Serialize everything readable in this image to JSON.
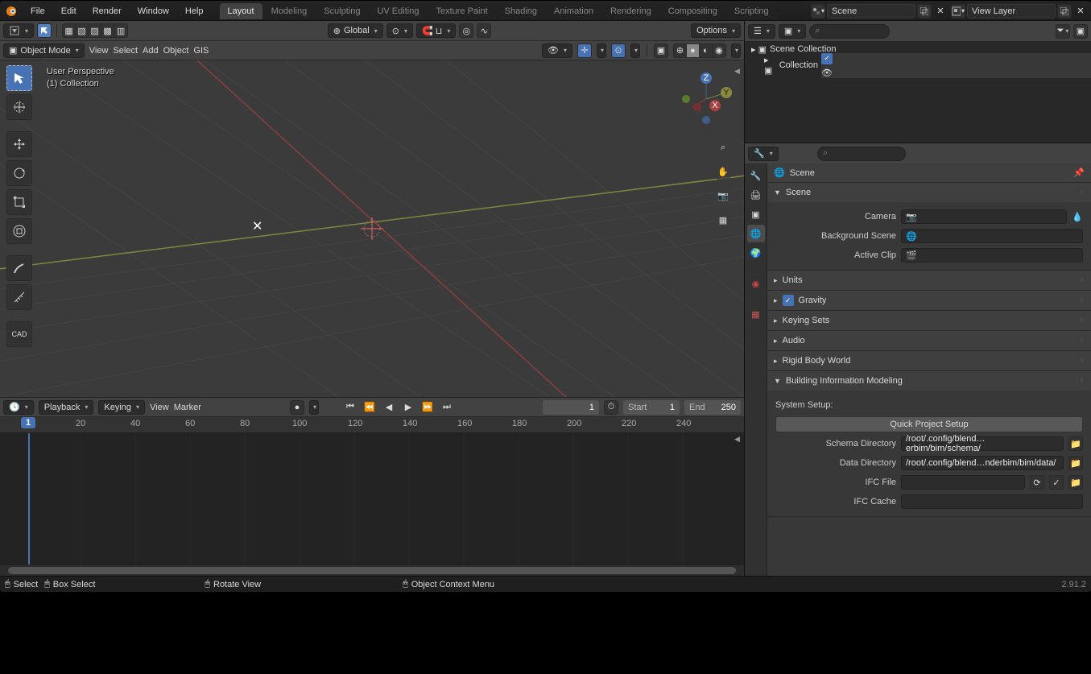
{
  "menubar": {
    "items": [
      "File",
      "Edit",
      "Render",
      "Window",
      "Help"
    ]
  },
  "tabs": [
    "Layout",
    "Modeling",
    "Sculpting",
    "UV Editing",
    "Texture Paint",
    "Shading",
    "Animation",
    "Rendering",
    "Compositing",
    "Scripting"
  ],
  "activeTab": "Layout",
  "sceneField": {
    "label": "Scene"
  },
  "viewLayerField": {
    "label": "View Layer"
  },
  "viewport": {
    "modeDropdown": "Object Mode",
    "menu": [
      "View",
      "Select",
      "Add",
      "Object",
      "GIS"
    ],
    "orientation": "Global",
    "options": "Options",
    "overlayTitle": "User Perspective",
    "overlaySubtitle": "(1) Collection"
  },
  "timeline": {
    "menu": [
      "Playback",
      "Keying",
      "View",
      "Marker"
    ],
    "currentFrame": "1",
    "start": {
      "label": "Start",
      "value": "1"
    },
    "end": {
      "label": "End",
      "value": "250"
    },
    "ticks": [
      "20",
      "40",
      "60",
      "80",
      "100",
      "120",
      "140",
      "160",
      "180",
      "200",
      "220",
      "240"
    ]
  },
  "statusbar": {
    "items": [
      {
        "icon": "mouse-left",
        "text": "Select"
      },
      {
        "icon": "mouse-left",
        "text": "Box Select"
      },
      {
        "icon": "mouse-middle",
        "text": "Rotate View"
      },
      {
        "icon": "mouse-right",
        "text": "Object Context Menu"
      }
    ],
    "version": "2.91.2"
  },
  "outliner": {
    "root": "Scene Collection",
    "items": [
      {
        "indent": 1,
        "label": "Collection"
      }
    ]
  },
  "properties": {
    "breadcrumb": "Scene",
    "panels": {
      "sceneOpen": true,
      "sceneTitle": "Scene",
      "camera": {
        "label": "Camera",
        "value": ""
      },
      "bgscene": {
        "label": "Background Scene",
        "value": ""
      },
      "activeclip": {
        "label": "Active Clip",
        "value": ""
      },
      "units": "Units",
      "gravity": "Gravity",
      "keying": "Keying Sets",
      "audio": "Audio",
      "rigid": "Rigid Body World",
      "bim": "Building Information Modeling",
      "systemSetup": "System Setup:",
      "quickSetup": "Quick Project Setup",
      "schemaDir": {
        "label": "Schema Directory",
        "value": "/root/.config/blend…erbim/bim/schema/"
      },
      "dataDir": {
        "label": "Data Directory",
        "value": "/root/.config/blend…nderbim/bim/data/"
      },
      "ifcFile": {
        "label": "IFC File",
        "value": ""
      },
      "ifcCache": {
        "label": "IFC Cache",
        "value": ""
      }
    }
  }
}
